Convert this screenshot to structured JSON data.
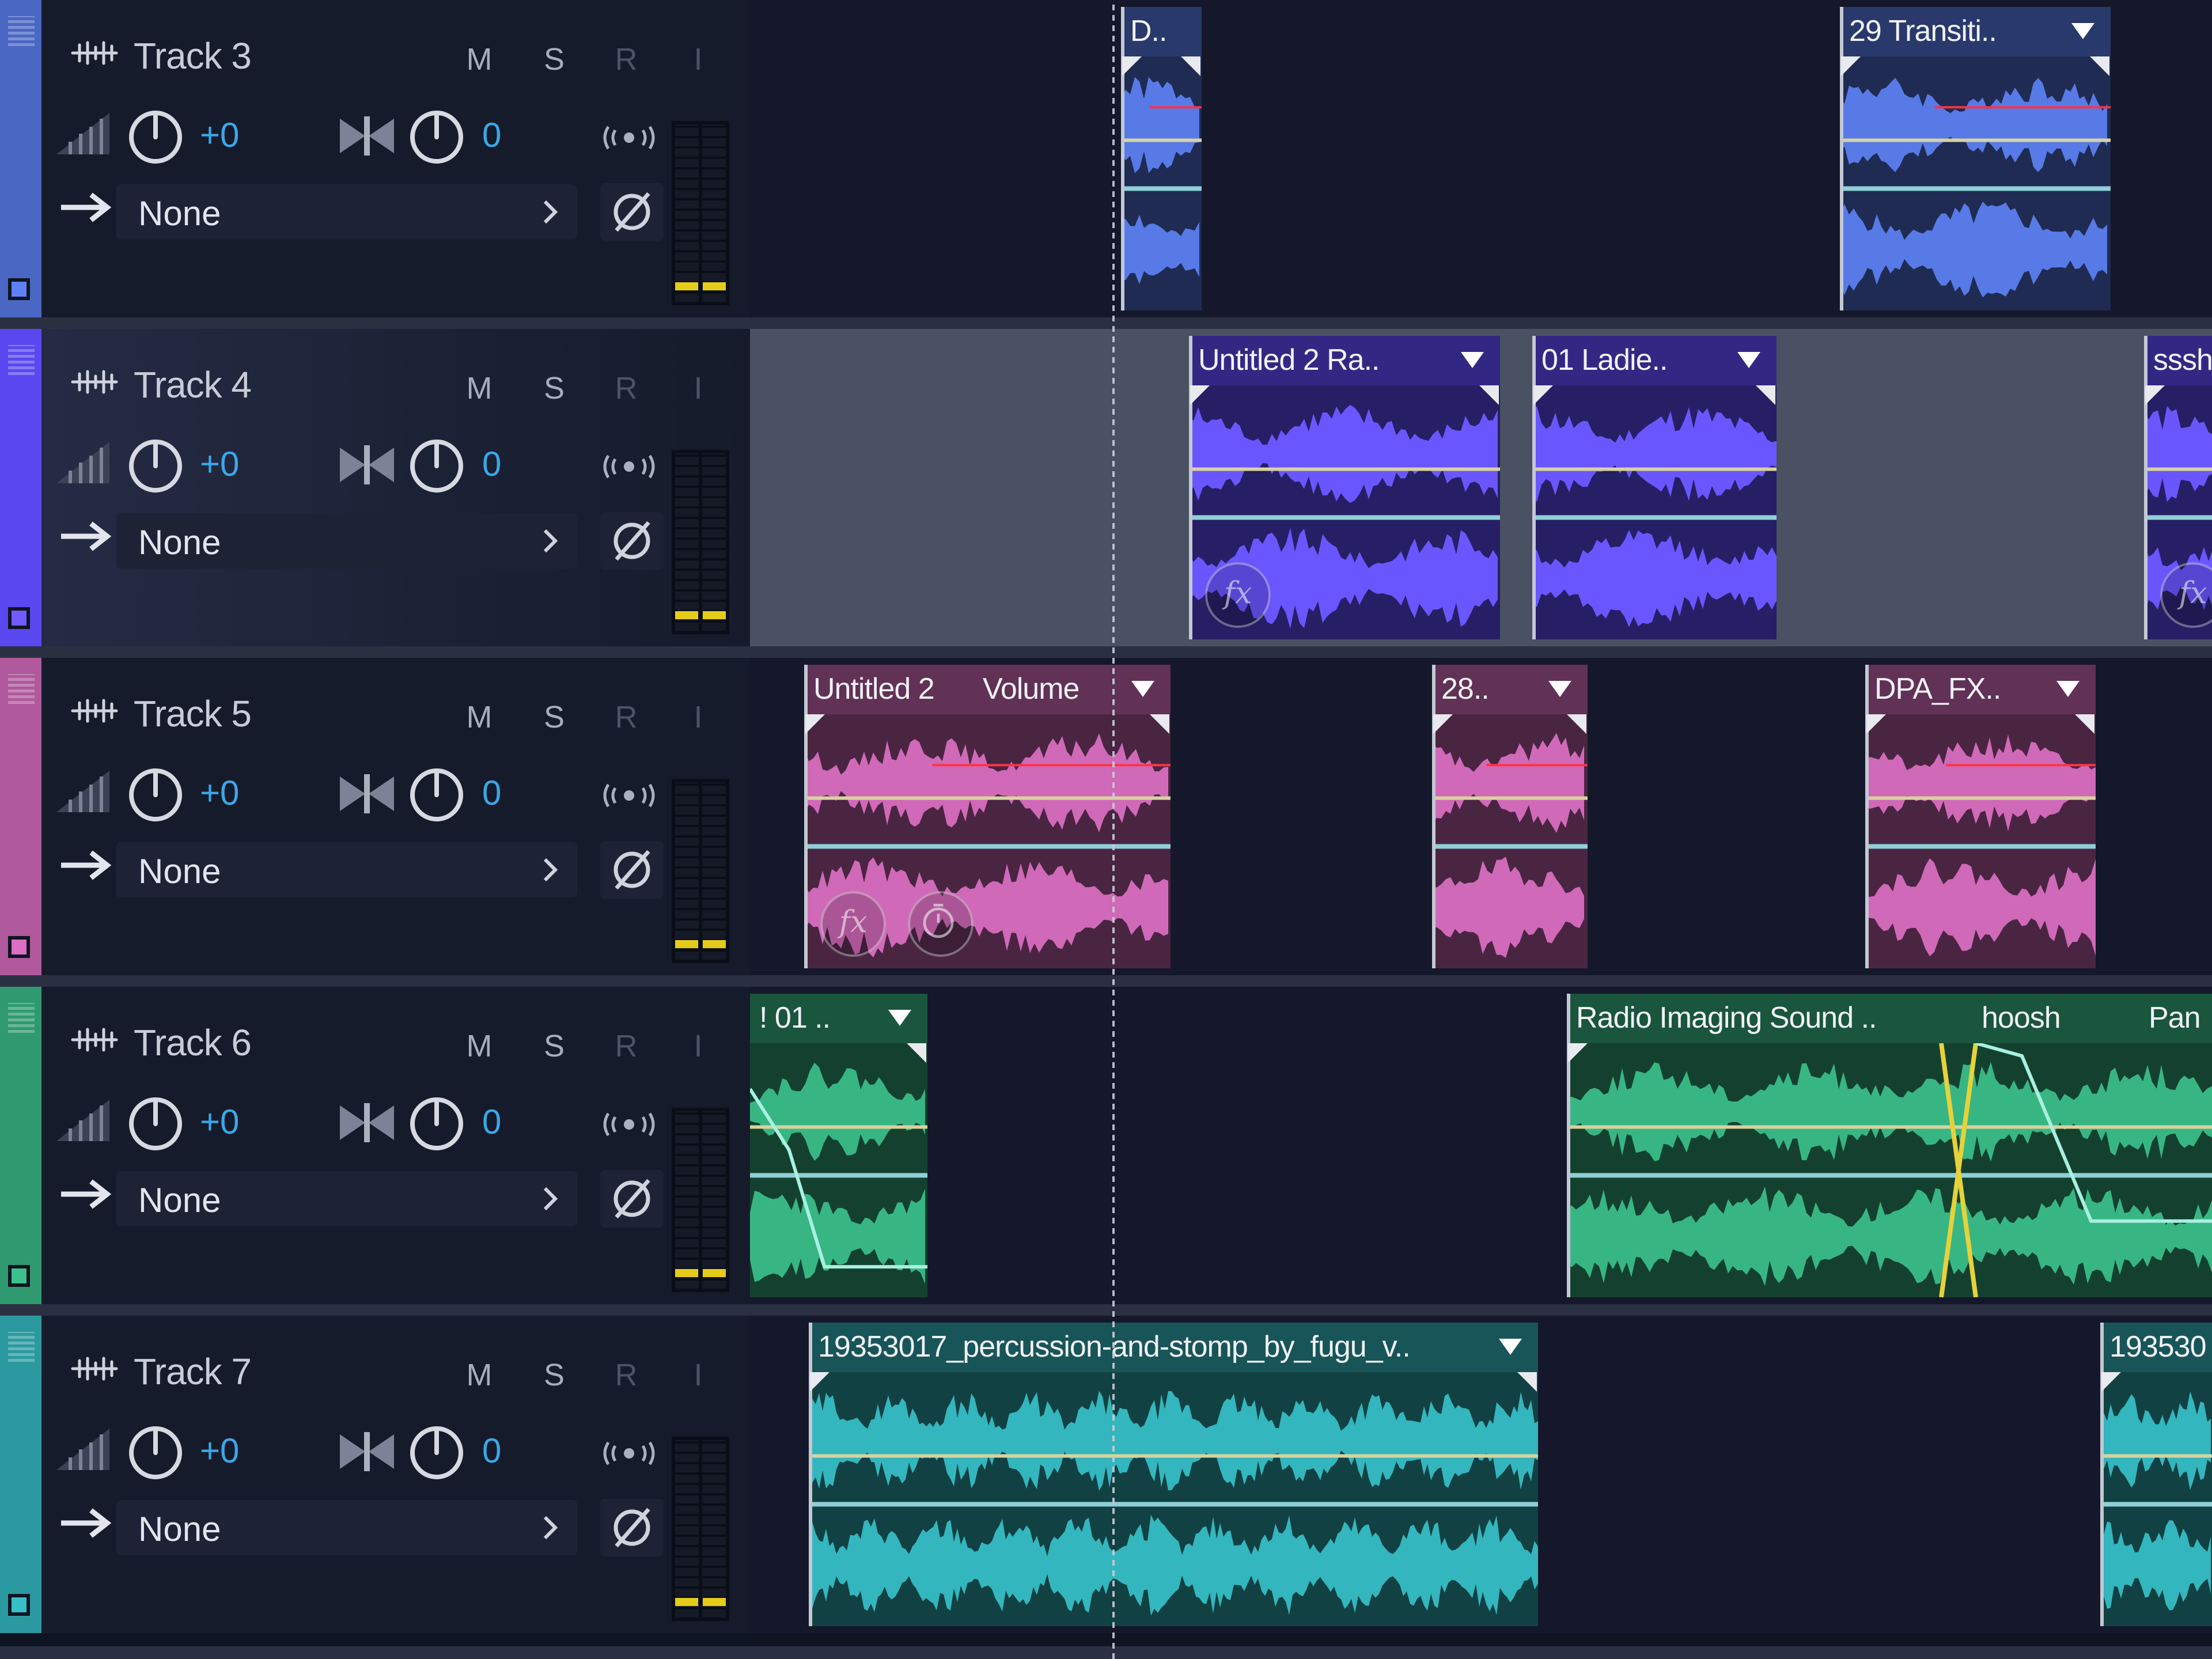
{
  "colors": {
    "track3": "#4a67c4",
    "track4": "#5a49f0",
    "track5": "#b0599c",
    "track6": "#2f9a70",
    "track7": "#2b9aa0",
    "accent_value": "#3aa8e8",
    "meter_peak": "#e6cc1a"
  },
  "buttons": {
    "mute": "M",
    "solo": "S",
    "record": "R",
    "input": "I"
  },
  "tracks": [
    {
      "name": "Track 3",
      "volume": "+0",
      "pan": "0",
      "route": "None",
      "clips": [
        {
          "title": "D.."
        },
        {
          "title": "29 Transiti.."
        }
      ]
    },
    {
      "name": "Track 4",
      "volume": "+0",
      "pan": "0",
      "route": "None",
      "clips": [
        {
          "title": "Untitled 2 Ra.."
        },
        {
          "title": "01 Ladie.."
        },
        {
          "title": "ssshh"
        }
      ]
    },
    {
      "name": "Track 5",
      "volume": "+0",
      "pan": "0",
      "route": "None",
      "clips": [
        {
          "title": "Untitled 2",
          "param": "Volume"
        },
        {
          "title": "28.."
        },
        {
          "title": "DPA_FX.."
        }
      ]
    },
    {
      "name": "Track 6",
      "volume": "+0",
      "pan": "0",
      "route": "None",
      "clips": [
        {
          "title": "! 01 .."
        },
        {
          "title": "Radio Imaging Sound ..",
          "title2": "hoosh",
          "param": "Pan"
        }
      ]
    },
    {
      "name": "Track 7",
      "volume": "+0",
      "pan": "0",
      "route": "None",
      "clips": [
        {
          "title": "19353017_percussion-and-stomp_by_fugu_v.."
        },
        {
          "title": "193530"
        }
      ]
    }
  ],
  "fx_label": "fx",
  "icons": {
    "track_type": "waveform-icon",
    "volume": "volume-ramp-icon",
    "pan": "pan-icon",
    "send": "send-broadcast-icon",
    "route": "arrow-right-icon",
    "phase": "phase-invert-icon",
    "chevron": "chevron-right-icon",
    "clip_menu": "caret-down-icon",
    "fx": "fx-icon",
    "clip_time": "time-stretch-icon"
  }
}
